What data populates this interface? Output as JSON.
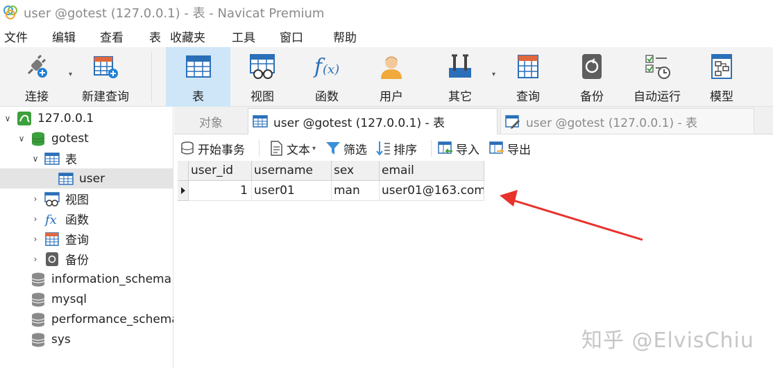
{
  "window": {
    "title": "user @gotest (127.0.0.1) - 表 - Navicat Premium"
  },
  "menu": [
    "文件",
    "编辑",
    "查看",
    "表",
    "收藏夹",
    "工具",
    "窗口",
    "帮助"
  ],
  "toolbar": {
    "connect": "连接",
    "new_query": "新建查询",
    "table": "表",
    "view": "视图",
    "function": "函数",
    "user": "用户",
    "other": "其它",
    "query": "查询",
    "backup": "备份",
    "automation": "自动运行",
    "model": "模型"
  },
  "tree": {
    "connection": "127.0.0.1",
    "database": "gotest",
    "tables_group": "表",
    "table_user": "user",
    "views": "视图",
    "functions": "函数",
    "queries": "查询",
    "backups": "备份",
    "other_dbs": [
      "information_schema",
      "mysql",
      "performance_schema",
      "sys"
    ]
  },
  "tabs": {
    "objects": "对象",
    "active": "user @gotest (127.0.0.1) - 表",
    "inactive": "user @gotest (127.0.0.1) - 表"
  },
  "subtoolbar": {
    "begin_transaction": "开始事务",
    "text": "文本",
    "filter": "筛选",
    "sort": "排序",
    "import": "导入",
    "export": "导出"
  },
  "grid": {
    "columns": [
      "user_id",
      "username",
      "sex",
      "email"
    ],
    "rows": [
      [
        "1",
        "user01",
        "man",
        "user01@163.com"
      ]
    ]
  },
  "colors": {
    "accent": "#1e7fd6",
    "active_tool_bg": "#cfe6f8",
    "arrow": "#e8322c"
  },
  "watermark": "知乎 @ElvisChiu"
}
